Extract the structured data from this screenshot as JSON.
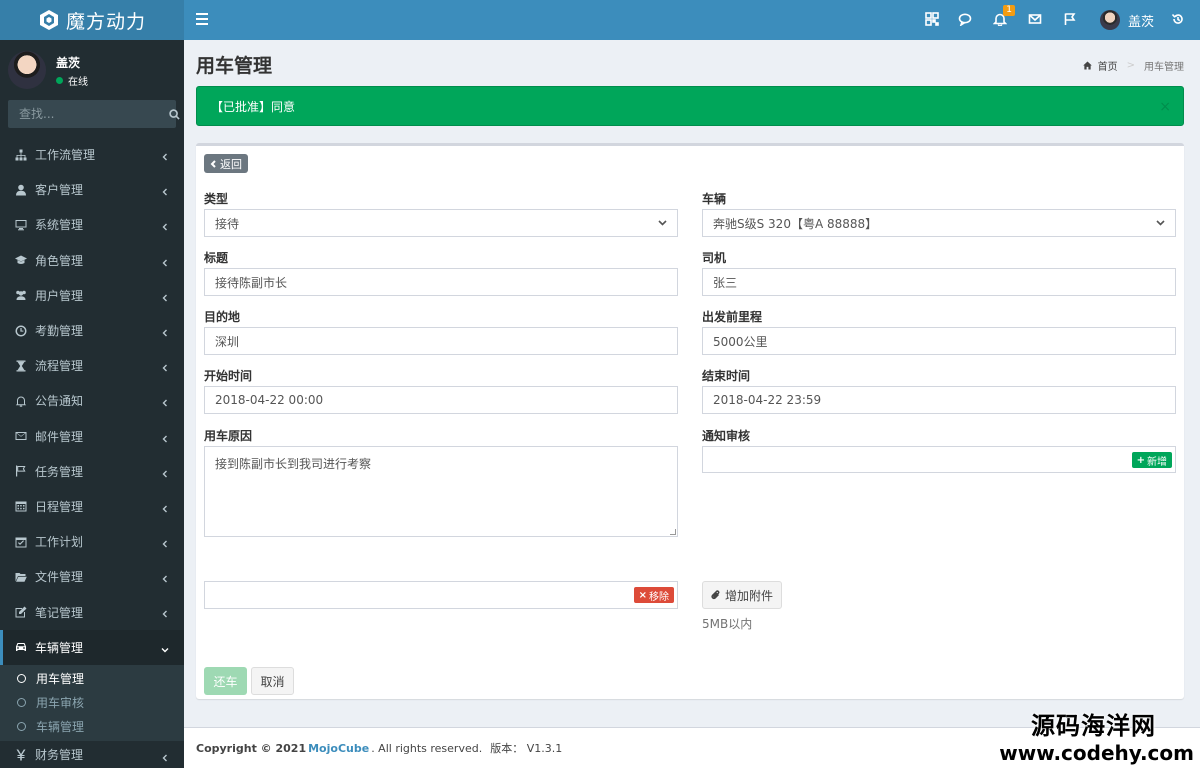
{
  "brand": {
    "name": "魔方动力"
  },
  "topbar": {
    "notification_count": "1",
    "user_name": "盖茨"
  },
  "sidebar": {
    "user": {
      "name": "盖茨",
      "status": "在线"
    },
    "search_placeholder": "查找...",
    "items": [
      {
        "label": "工作流管理",
        "icon": "sitemap-icon"
      },
      {
        "label": "客户管理",
        "icon": "user-icon"
      },
      {
        "label": "系统管理",
        "icon": "desktop-icon"
      },
      {
        "label": "角色管理",
        "icon": "graduation-cap-icon"
      },
      {
        "label": "用户管理",
        "icon": "users-icon"
      },
      {
        "label": "考勤管理",
        "icon": "clock-icon"
      },
      {
        "label": "流程管理",
        "icon": "hourglass-icon"
      },
      {
        "label": "公告通知",
        "icon": "bell-icon"
      },
      {
        "label": "邮件管理",
        "icon": "envelope-icon"
      },
      {
        "label": "任务管理",
        "icon": "flag-icon"
      },
      {
        "label": "日程管理",
        "icon": "calendar-icon"
      },
      {
        "label": "工作计划",
        "icon": "calendar-check-icon"
      },
      {
        "label": "文件管理",
        "icon": "folder-open-icon"
      },
      {
        "label": "笔记管理",
        "icon": "edit-icon"
      },
      {
        "label": "车辆管理",
        "icon": "car-icon"
      },
      {
        "label": "财务管理",
        "icon": "yen-icon"
      }
    ],
    "submenu": [
      {
        "label": "用车管理"
      },
      {
        "label": "用车审核"
      },
      {
        "label": "车辆管理"
      }
    ]
  },
  "page": {
    "title": "用车管理",
    "breadcrumb": {
      "home": "首页",
      "current": "用车管理"
    }
  },
  "alert": {
    "text": "【已批准】同意"
  },
  "form": {
    "back_label": "返回",
    "type": {
      "label": "类型",
      "value": "接待"
    },
    "vehicle": {
      "label": "车辆",
      "value": "奔驰S级S 320【粤A 88888】"
    },
    "subject": {
      "label": "标题",
      "value": "接待陈副市长"
    },
    "driver": {
      "label": "司机",
      "value": "张三"
    },
    "destination": {
      "label": "目的地",
      "value": "深圳"
    },
    "odometer": {
      "label": "出发前里程",
      "value": "5000公里"
    },
    "start_time": {
      "label": "开始时间",
      "value": "2018-04-22 00:00"
    },
    "end_time": {
      "label": "结束时间",
      "value": "2018-04-22 23:59"
    },
    "reason": {
      "label": "用车原因",
      "value": "接到陈副市长到我司进行考察"
    },
    "notify": {
      "label": "通知审核",
      "add_label": "新增"
    },
    "remove_label": "移除",
    "attach_label": "增加附件",
    "attach_hint": "5MB以内",
    "return_label": "还车",
    "cancel_label": "取消"
  },
  "footer": {
    "copyright": "Copyright © 2021",
    "brand": "MojoCube",
    "rights": ". All rights reserved.",
    "version": "版本： V1.3.1"
  },
  "watermark": {
    "title": "源码海洋网",
    "url": "www.codehy.com"
  }
}
